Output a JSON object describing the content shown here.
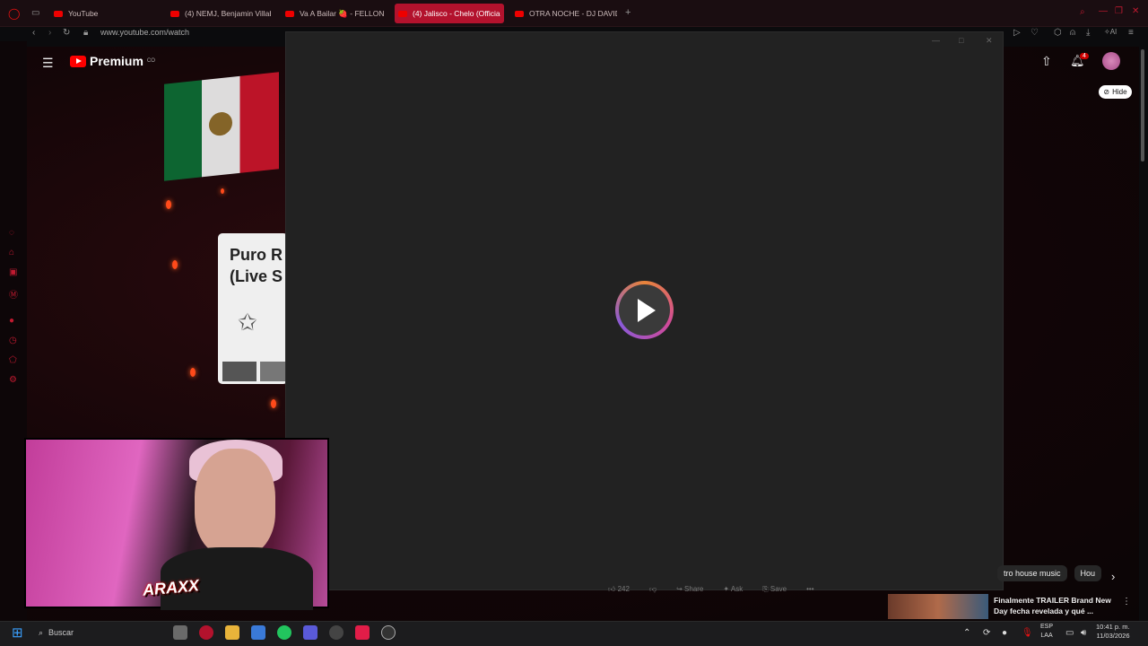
{
  "tabs": [
    {
      "label": "YouTube",
      "active": false
    },
    {
      "label": "(4) NEMJ, Benjamin Villab",
      "active": false
    },
    {
      "label": "Va A Bailar 🍓 - FELLON",
      "active": false
    },
    {
      "label": "(4) Jalisco - Chelo (Officia",
      "active": true
    },
    {
      "label": "OTRA NOCHE - DJ DAVID",
      "active": false
    }
  ],
  "new_tab": "+",
  "url": "www.youtube.com/watch",
  "youtube": {
    "logo": "Premium",
    "country": "CO",
    "notifications": "4",
    "hide_label": "Hide",
    "album_line1": "Puro R",
    "album_line2": "(Live S"
  },
  "actions": {
    "likes": "242",
    "share": "Share",
    "ask": "Ask",
    "save": "Save",
    "more": "•••"
  },
  "chips": [
    "tro house music",
    "Hou"
  ],
  "recommendation": {
    "title": "Finalmente TRAILER Brand New Day fecha revelada y qué ..."
  },
  "webcam": {
    "overlay_text": "ARAXX"
  },
  "taskbar": {
    "search_placeholder": "Buscar",
    "lang_line1": "ESP",
    "lang_line2": "LAA",
    "time": "10:41 p. m.",
    "date": "11/03/2026"
  },
  "colors": {
    "accent": "#b3122d",
    "youtube_red": "#ff0000",
    "player_bg": "#222222"
  }
}
